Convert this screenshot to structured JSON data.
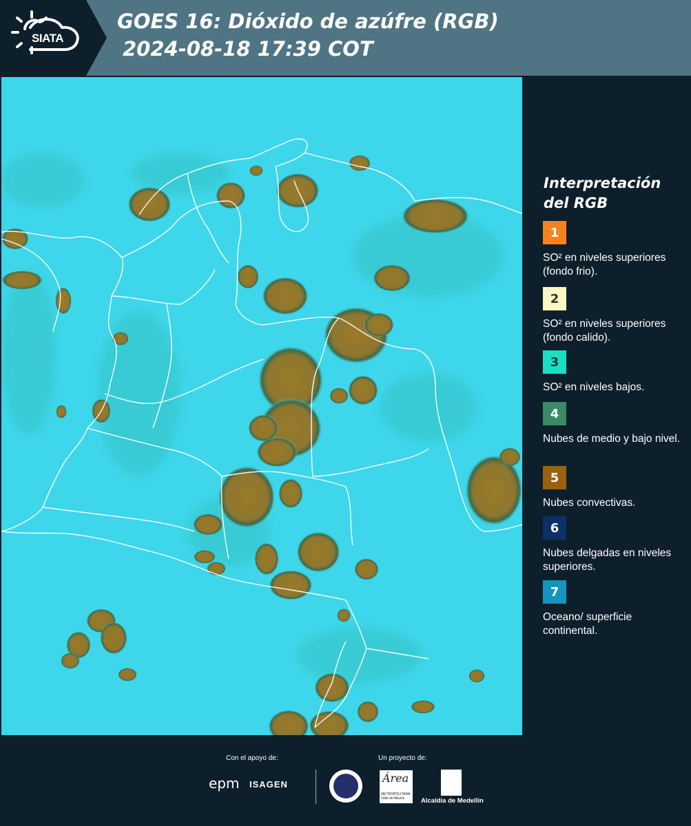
{
  "header": {
    "logo_text": "SIATA",
    "title_line1": "GOES 16: Dióxido de azúfre (RGB)",
    "title_line2": "2024-08-18 17:39 COT"
  },
  "legend": {
    "title": "Interpretación del RGB",
    "items": [
      {
        "number": "1",
        "color": "#f5821f",
        "text_color": "#ffffff",
        "label": "SO² en niveles superiores (fondo frio)."
      },
      {
        "number": "2",
        "color": "#fff7c2",
        "text_color": "#333333",
        "label": "SO² en niveles superiores (fondo calido)."
      },
      {
        "number": "3",
        "color": "#19e0c3",
        "text_color": "#1b3a3a",
        "label": "SO² en niveles bajos."
      },
      {
        "number": "4",
        "color": "#3a8a65",
        "text_color": "#ffffff",
        "label": "Nubes de medio y bajo nivel."
      },
      {
        "number": "5",
        "color": "#99600f",
        "text_color": "#ffffff",
        "label": "Nubes convectivas."
      },
      {
        "number": "6",
        "color": "#0d3166",
        "text_color": "#ffffff",
        "label": "Nubes delgadas en niveles superiores."
      },
      {
        "number": "7",
        "color": "#1594c0",
        "text_color": "#ffffff",
        "label": "Oceano/ superficie continental."
      }
    ]
  },
  "map": {
    "background_color": "#3ed6ea",
    "cloud_color": "#957a2c",
    "border_color": "#ffffff"
  },
  "footer": {
    "support_label": "Con el apoyo de:",
    "project_label": "Un proyecto de:",
    "epm_text": "epm",
    "isagen_text": "ISAGEN",
    "area_logo_text": "Área",
    "area_logo_subtext": "METROPOLITANA Valle de Aburrá",
    "alcaldia_text": "Alcaldía de Medellín"
  }
}
